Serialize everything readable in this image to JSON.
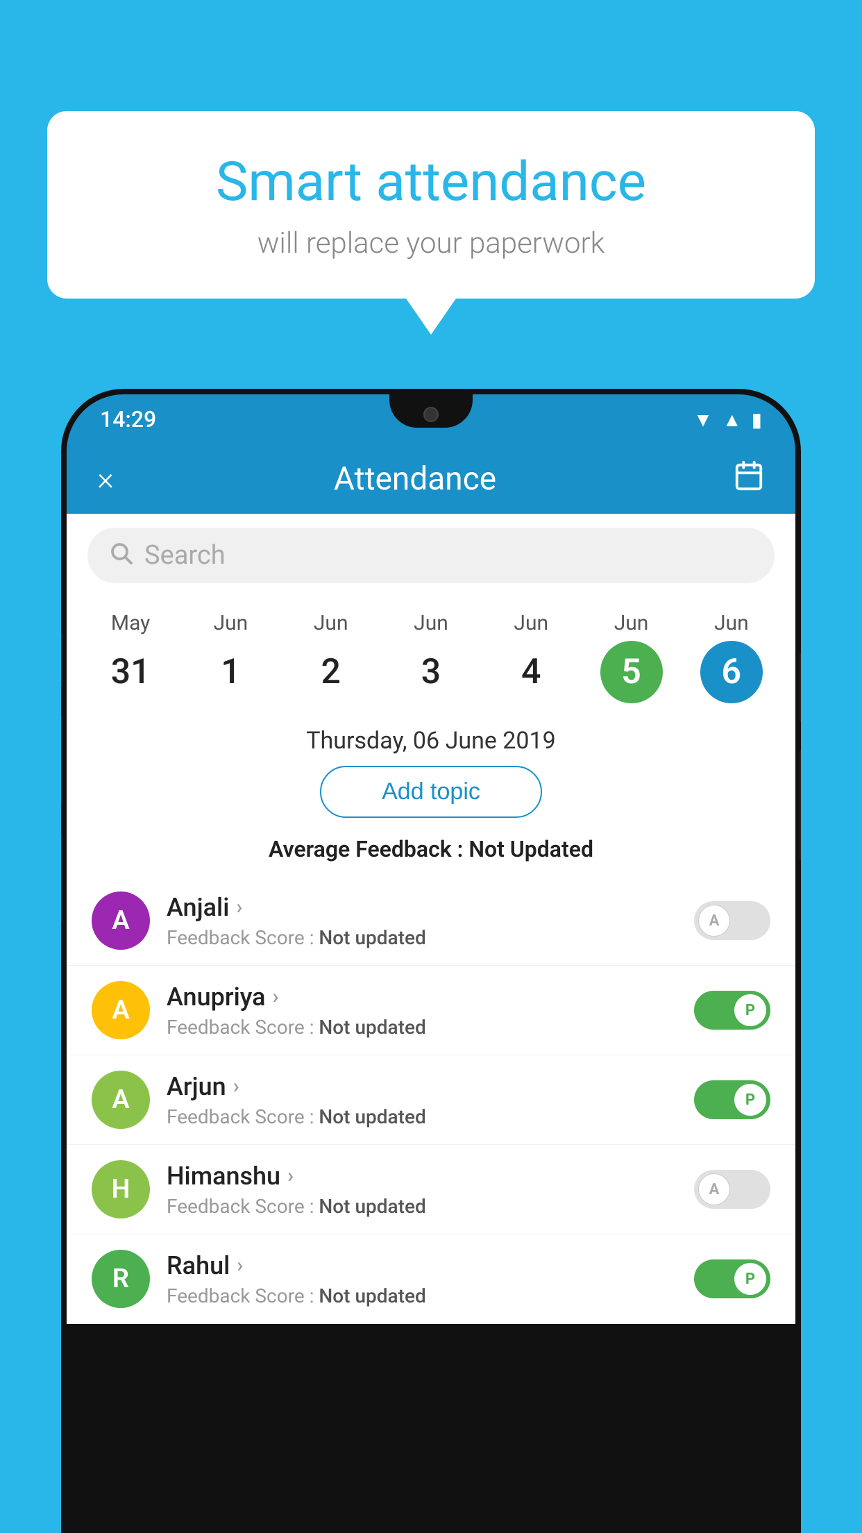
{
  "background_color": "#29b6e8",
  "bubble": {
    "title": "Smart attendance",
    "subtitle": "will replace your paperwork"
  },
  "status_bar": {
    "time": "14:29",
    "icons": [
      "wifi",
      "signal",
      "battery"
    ]
  },
  "header": {
    "title": "Attendance",
    "close_label": "×",
    "calendar_label": "📅"
  },
  "search": {
    "placeholder": "Search"
  },
  "dates": [
    {
      "month": "May",
      "day": "31",
      "state": "normal"
    },
    {
      "month": "Jun",
      "day": "1",
      "state": "normal"
    },
    {
      "month": "Jun",
      "day": "2",
      "state": "normal"
    },
    {
      "month": "Jun",
      "day": "3",
      "state": "normal"
    },
    {
      "month": "Jun",
      "day": "4",
      "state": "normal"
    },
    {
      "month": "Jun",
      "day": "5",
      "state": "today"
    },
    {
      "month": "Jun",
      "day": "6",
      "state": "selected"
    }
  ],
  "selected_date": "Thursday, 06 June 2019",
  "add_topic_label": "Add topic",
  "average_feedback": {
    "label": "Average Feedback : ",
    "value": "Not Updated"
  },
  "students": [
    {
      "name": "Anjali",
      "avatar_letter": "A",
      "avatar_color": "#9c27b0",
      "feedback_label": "Feedback Score : ",
      "feedback_value": "Not updated",
      "attendance": "absent",
      "toggle_letter": "A"
    },
    {
      "name": "Anupriya",
      "avatar_letter": "A",
      "avatar_color": "#ffc107",
      "feedback_label": "Feedback Score : ",
      "feedback_value": "Not updated",
      "attendance": "present",
      "toggle_letter": "P"
    },
    {
      "name": "Arjun",
      "avatar_letter": "A",
      "avatar_color": "#8bc34a",
      "feedback_label": "Feedback Score : ",
      "feedback_value": "Not updated",
      "attendance": "present",
      "toggle_letter": "P"
    },
    {
      "name": "Himanshu",
      "avatar_letter": "H",
      "avatar_color": "#8bc34a",
      "feedback_label": "Feedback Score : ",
      "feedback_value": "Not updated",
      "attendance": "absent",
      "toggle_letter": "A"
    },
    {
      "name": "Rahul",
      "avatar_letter": "R",
      "avatar_color": "#4caf50",
      "feedback_label": "Feedback Score : ",
      "feedback_value": "Not updated",
      "attendance": "present",
      "toggle_letter": "P"
    }
  ]
}
